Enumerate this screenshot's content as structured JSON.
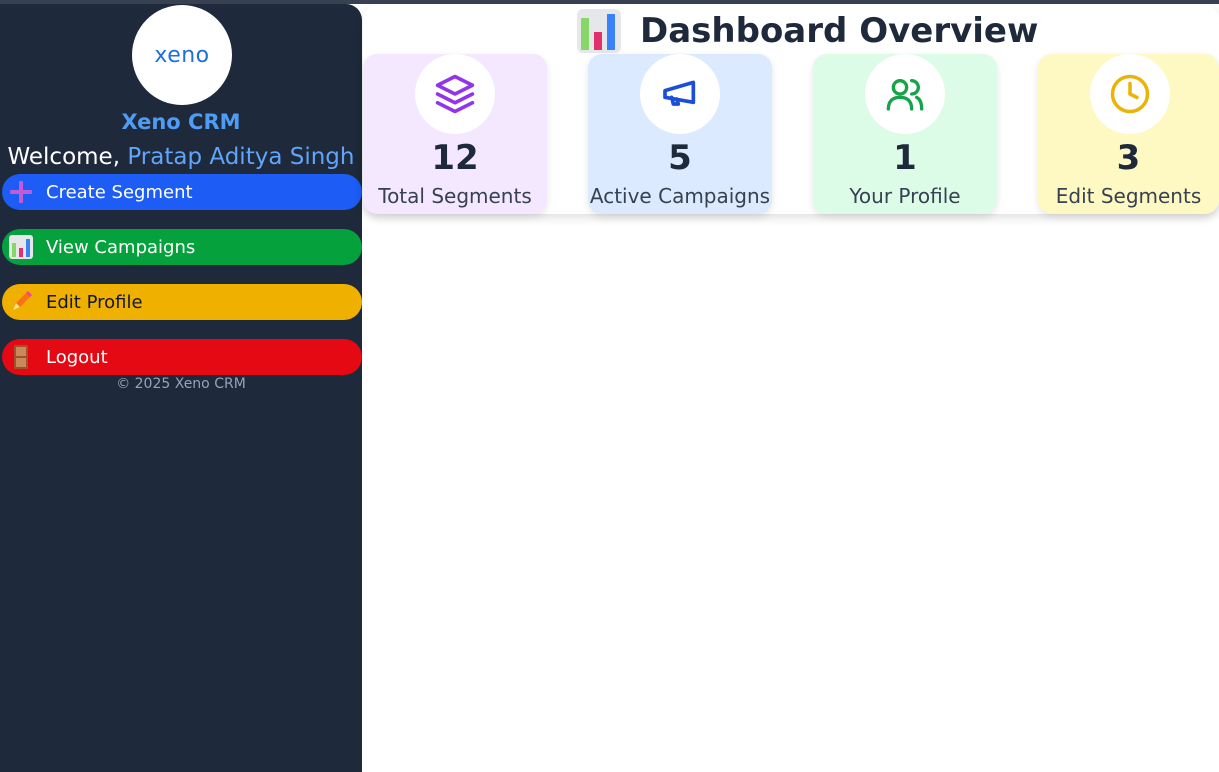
{
  "sidebar": {
    "logo_text": "xeno",
    "brand": "Xeno CRM",
    "welcome_prefix": "Welcome,",
    "user_name": "Pratap Aditya Singh",
    "nav": [
      {
        "label": "Create Segment",
        "icon": "plus-icon",
        "color": "#1d5cf5"
      },
      {
        "label": "View Campaigns",
        "icon": "bar-chart-icon",
        "color": "#04a13c"
      },
      {
        "label": "Edit Profile",
        "icon": "pencil-icon",
        "color": "#f0b000"
      },
      {
        "label": "Logout",
        "icon": "door-icon",
        "color": "#e50914"
      }
    ],
    "copyright": "© 2025 Xeno CRM"
  },
  "main": {
    "title": "Dashboard Overview",
    "title_icon": "bar-chart-icon",
    "cards": [
      {
        "count": "12",
        "label": "Total Segments",
        "icon": "layers-icon",
        "color": "#9333ea",
        "bg": "#f3e8ff"
      },
      {
        "count": "5",
        "label": "Active Campaigns",
        "icon": "megaphone-icon",
        "color": "#1d4ed8",
        "bg": "#dbeafe"
      },
      {
        "count": "1",
        "label": "Your Profile",
        "icon": "users-icon",
        "color": "#16a34a",
        "bg": "#dcfce7"
      },
      {
        "count": "3",
        "label": "Edit Segments",
        "icon": "clock-icon",
        "color": "#eab308",
        "bg": "#fef9c3"
      }
    ]
  }
}
